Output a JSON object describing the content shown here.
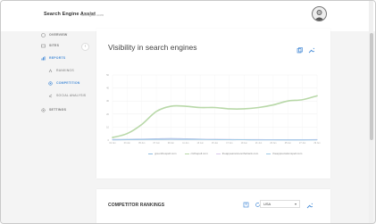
{
  "app": {
    "title": "Search Engine Assist",
    "subtitle": "seengine.com"
  },
  "sidebar": {
    "items": [
      {
        "label": "OVERVIEW",
        "icon": "overview-icon"
      },
      {
        "label": "SITES",
        "icon": "sites-icon"
      },
      {
        "label": "REPORTS",
        "icon": "reports-icon"
      }
    ],
    "subitems": [
      {
        "label": "RANKINGS",
        "icon": "rankings-icon"
      },
      {
        "label": "COMPETITION",
        "icon": "competition-icon"
      },
      {
        "label": "SOCIAL ANALYSIS",
        "icon": "social-icon"
      }
    ],
    "settings": {
      "label": "SETTINGS",
      "icon": "gear-icon"
    }
  },
  "visibility": {
    "title": "Visibility in search engines",
    "legend": [
      "greenthespell.com",
      "ctcthepell.com",
      "theappearanceonthebank.com",
      "theappreciationspell.com"
    ]
  },
  "chart_data": {
    "type": "line",
    "title": "Visibility in search engines",
    "x": [
      "01 Jun",
      "03 Jun",
      "05 Jun",
      "07 Jun",
      "09 Jun",
      "11 Jun",
      "13 Jun",
      "15 Jun",
      "17 Jun",
      "19 Jun",
      "21 Jun",
      "23 Jun",
      "25 Jun",
      "27 Jun",
      "29 Jun"
    ],
    "yticks": [
      "50",
      "40",
      "30",
      "20",
      "10",
      "0"
    ],
    "ylim": [
      0,
      50
    ],
    "grid": true,
    "legend_position": "bottom",
    "series": [
      {
        "name": "greenthespell.com",
        "color": "#8fbce0",
        "values": [
          0.5,
          0.6,
          0.8,
          1.0,
          1.2,
          1.0,
          0.8,
          0.6,
          0.4,
          0.3,
          0.3,
          0.3,
          0.2,
          0.2,
          0.3
        ]
      },
      {
        "name": "ctcthepell.com",
        "color": "#b8d8a8",
        "values": [
          2,
          5,
          12,
          22,
          26,
          26,
          25,
          25,
          24,
          24,
          25,
          27,
          30,
          31,
          34
        ]
      },
      {
        "name": "theappearanceonthebank.com",
        "color": "#d9c7ec",
        "values": [
          0.4,
          0.5,
          0.6,
          0.8,
          0.9,
          0.8,
          0.7,
          0.6,
          0.5,
          0.4,
          0.4,
          0.3,
          0.3,
          0.3,
          0.4
        ]
      },
      {
        "name": "theappreciationspell.com",
        "color": "#9ec9e6",
        "values": [
          0.2,
          0.3,
          0.4,
          0.5,
          0.6,
          0.5,
          0.5,
          0.4,
          0.3,
          0.3,
          0.2,
          0.2,
          0.2,
          0.2,
          0.2
        ]
      }
    ]
  },
  "rankings": {
    "title": "COMPETITOR RANKINGS",
    "country": "USA"
  }
}
